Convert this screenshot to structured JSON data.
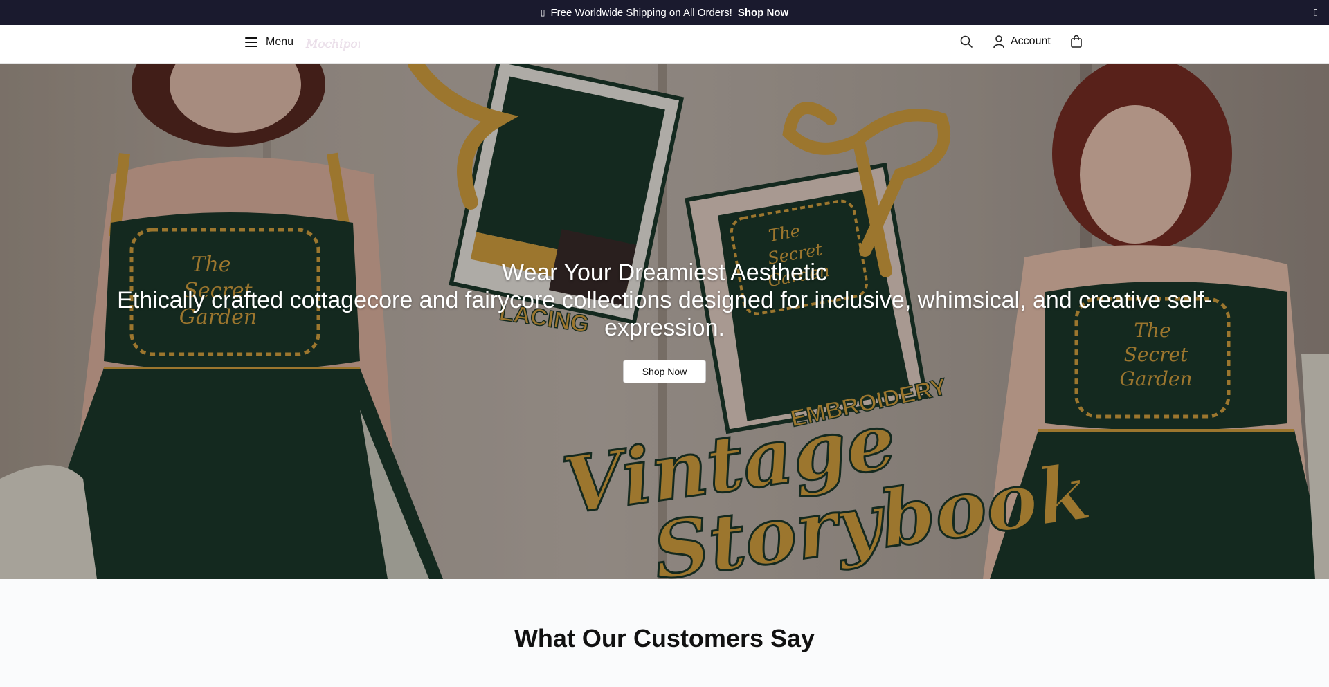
{
  "announcement": {
    "glyph": "▯",
    "text": "Free Worldwide Shipping on All Orders!",
    "link": "Shop Now",
    "close": "▯"
  },
  "header": {
    "menu_label": "Menu",
    "logo_text": "Mochipon",
    "account_label": "Account",
    "icons": [
      "menu-icon",
      "search-icon",
      "user-icon",
      "bag-icon"
    ]
  },
  "hero": {
    "title": "Wear Your Dreamiest Aesthetic",
    "subtitle": "Ethically crafted cottagecore and fairycore collections designed for inclusive, whimsical, and creative self-expression.",
    "button": "Shop Now",
    "image_text": {
      "panel_left": [
        "The",
        "Secret",
        "Garden"
      ],
      "panel_mid": [
        "The",
        "Secret",
        "Garden"
      ],
      "panel_right": [
        "The",
        "Secret",
        "Garden"
      ],
      "lacing": "LACING",
      "embroidery": "EMBROIDERY",
      "script1": "Vintage",
      "script2": "Storybook"
    }
  },
  "testimonials": {
    "title": "What Our Customers Say"
  },
  "colors": {
    "announcement_bg": "#1a1a2e",
    "dress_green": "#1c3a2b",
    "ribbon_gold": "#d9a441"
  }
}
